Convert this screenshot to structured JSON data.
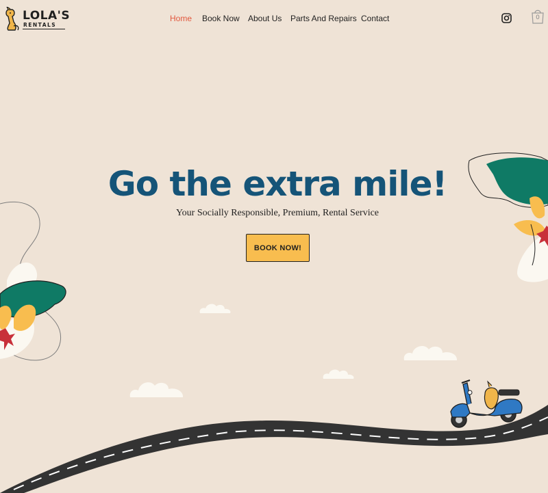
{
  "brand": {
    "name": "LOLA'S",
    "tagline": "RENTALS"
  },
  "nav": {
    "items": [
      {
        "label": "Home",
        "active": true
      },
      {
        "label": "Book Now",
        "active": false
      },
      {
        "label": "About Us",
        "active": false
      },
      {
        "label": "Parts And Repairs",
        "active": false
      },
      {
        "label": "Contact",
        "active": false
      }
    ],
    "active_color": "#e2583e"
  },
  "header_icons": {
    "social": "instagram-icon",
    "cart": "shopping-bag-icon",
    "cart_count": "0"
  },
  "hero": {
    "title": "Go the extra mile!",
    "subtitle": "Your Socially Responsible, Premium, Rental Service",
    "cta_label": "BOOK NOW!"
  },
  "colors": {
    "background": "#efe3d6",
    "title": "#155478",
    "cta": "#f8bd4f",
    "road": "#333333",
    "leaf_green": "#0f7a65",
    "leaf_yellow": "#f8bd4f",
    "flower_red": "#c8303a",
    "scooter": "#2f79c4"
  }
}
